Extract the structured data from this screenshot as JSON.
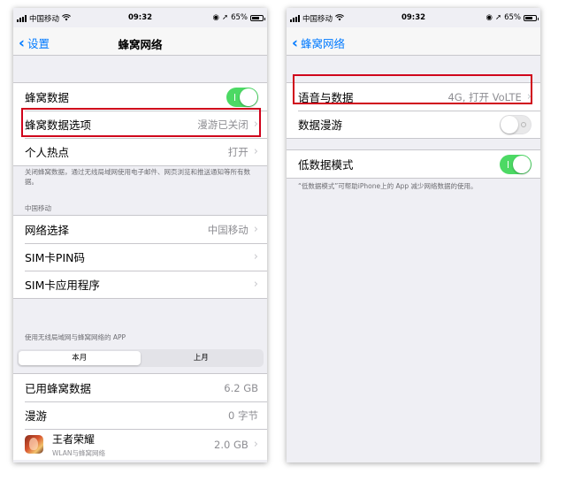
{
  "status_bar": {
    "carrier": "中国移动",
    "time": "09:32",
    "battery": "65%"
  },
  "left_screen": {
    "back_label": "设置",
    "title": "蜂窝网络",
    "rows_group1": [
      {
        "label": "蜂窝数据",
        "toggle": "on"
      },
      {
        "label": "蜂窝数据选项",
        "value": "漫游已关闭"
      },
      {
        "label": "个人热点",
        "value": "打开"
      }
    ],
    "footnote": "关闭蜂窝数据，通过无线局域网使用电子邮件、网页浏览和推送通知等所有数据。",
    "carrier_header": "中国移动",
    "rows_group2": [
      {
        "label": "网络选择",
        "value": "中国移动"
      },
      {
        "label": "SIM卡PIN码",
        "value": ""
      },
      {
        "label": "SIM卡应用程序",
        "value": ""
      }
    ],
    "usage_header": "使用无线局域网与蜂窝网络的 APP",
    "segments": [
      "本月",
      "上月"
    ],
    "rows_group3": [
      {
        "label": "已用蜂窝数据",
        "value": "6.2 GB"
      },
      {
        "label": "漫游",
        "value": "0 字节"
      }
    ],
    "app_row": {
      "name": "王者荣耀",
      "subtitle": "WLAN与蜂窝网络",
      "value": "2.0 GB",
      "icon": "honor-of-kings-app-icon"
    }
  },
  "right_screen": {
    "back_label": "蜂窝网络",
    "rows_group1": [
      {
        "label": "语音与数据",
        "value": "4G, 打开 VoLTE"
      },
      {
        "label": "数据漫游",
        "toggle": "off"
      }
    ],
    "rows_group2": [
      {
        "label": "低数据模式",
        "toggle": "on"
      }
    ],
    "footnote": "“低数据模式”可帮助iPhone上的 App 减少网络数据的使用。"
  },
  "colors": {
    "accent": "#007aff",
    "toggle_on": "#4cd964",
    "highlight": "#d0021b",
    "background": "#efeff4"
  }
}
